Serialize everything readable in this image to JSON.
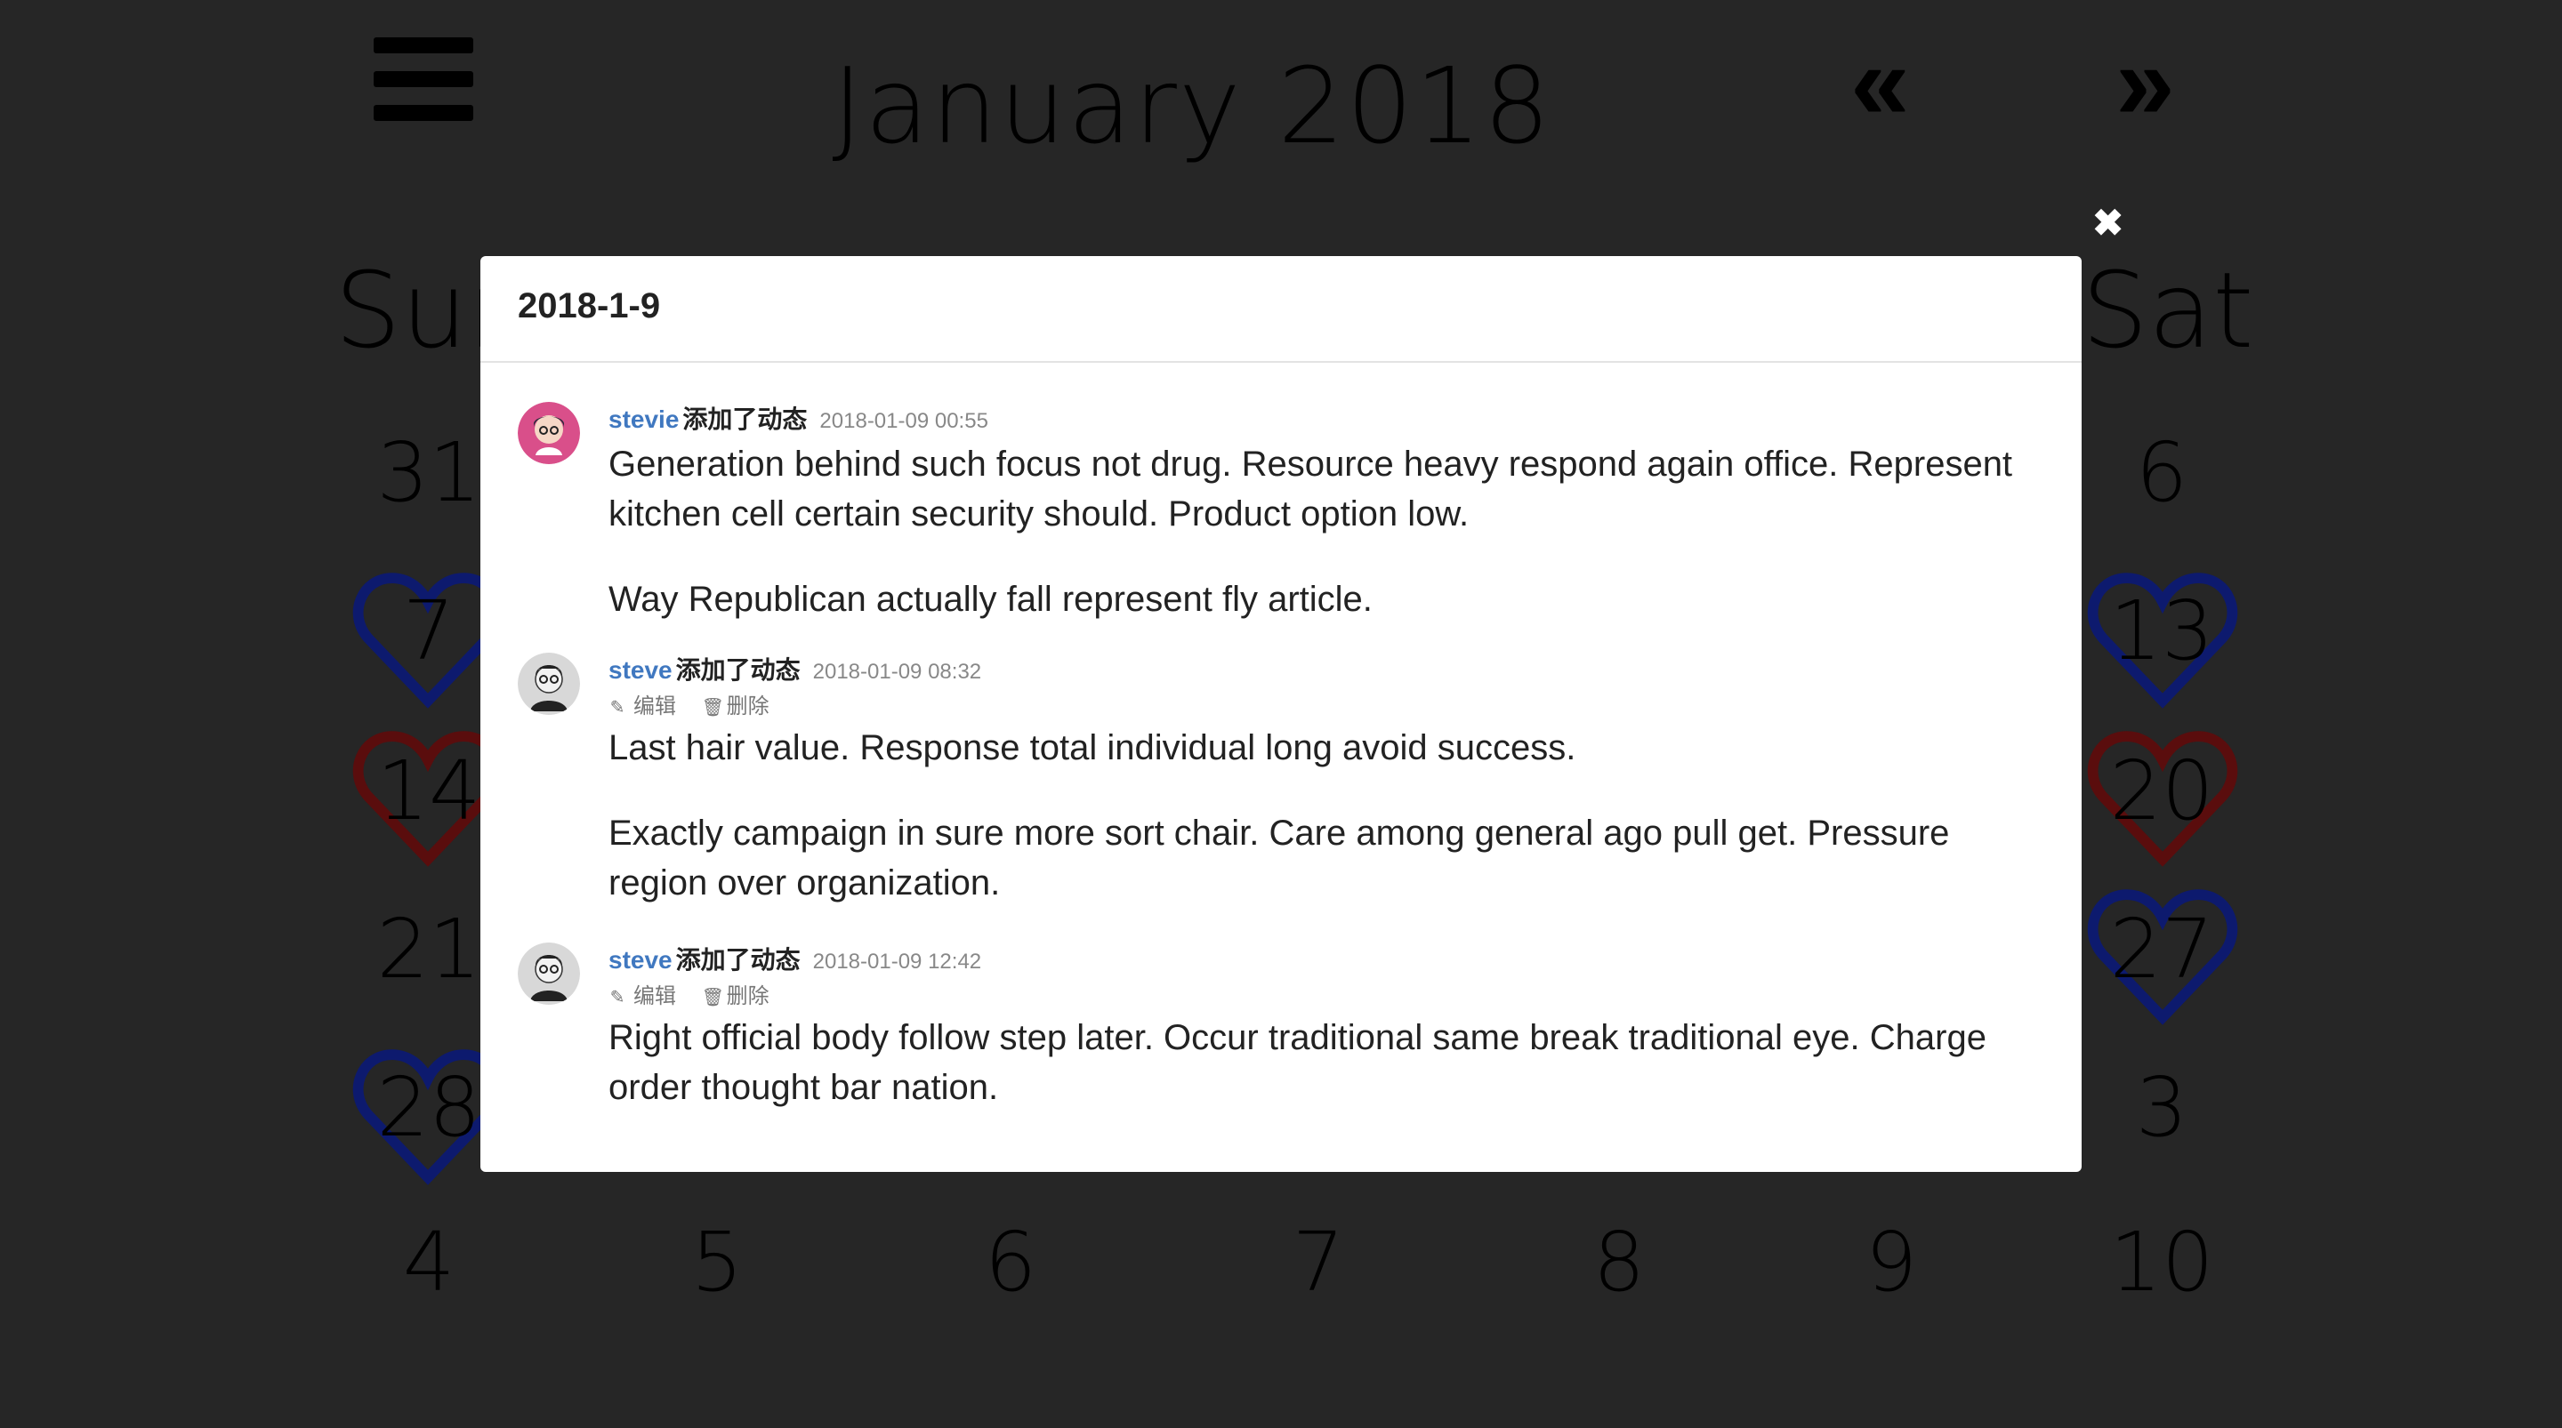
{
  "calendar": {
    "title": "January 2018",
    "prev_label": "«",
    "next_label": "»",
    "weekday_left": "Sun",
    "weekday_right": "Sat",
    "left_column": [
      "31",
      "7",
      "14",
      "21",
      "28",
      "4"
    ],
    "right_column": [
      "6",
      "13",
      "20",
      "27",
      "3",
      "10"
    ],
    "bottom_row": [
      "5",
      "6",
      "7",
      "8",
      "9"
    ],
    "heart_colors": {
      "blue": "#0d1a6e",
      "red": "#5a0d0d"
    }
  },
  "modal": {
    "close_label": "✖",
    "title": "2018-1-9",
    "events": [
      {
        "author": "stevie",
        "action": "添加了动态",
        "date": "2018-01-09 00:55",
        "avatar": "female-avatar-icon",
        "paragraphs": [
          "Generation behind such focus not drug. Resource heavy respond again office. Represent kitchen cell certain security should. Product option low.",
          "Way Republican actually fall represent fly article."
        ]
      },
      {
        "author": "steve",
        "action": "添加了动态",
        "date": "2018-01-09 08:32",
        "avatar": "male-avatar-icon",
        "edit_label": "编辑",
        "delete_label": "删除",
        "paragraphs": [
          "Last hair value. Response total individual long avoid success.",
          "Exactly campaign in sure more sort chair. Care among general ago pull get. Pressure region over organization."
        ]
      },
      {
        "author": "steve",
        "action": "添加了动态",
        "date": "2018-01-09 12:42",
        "avatar": "male-avatar-icon",
        "edit_label": "编辑",
        "delete_label": "删除",
        "paragraphs": [
          "Right official body follow step later. Occur traditional same break traditional eye. Charge order thought bar nation."
        ]
      }
    ]
  }
}
